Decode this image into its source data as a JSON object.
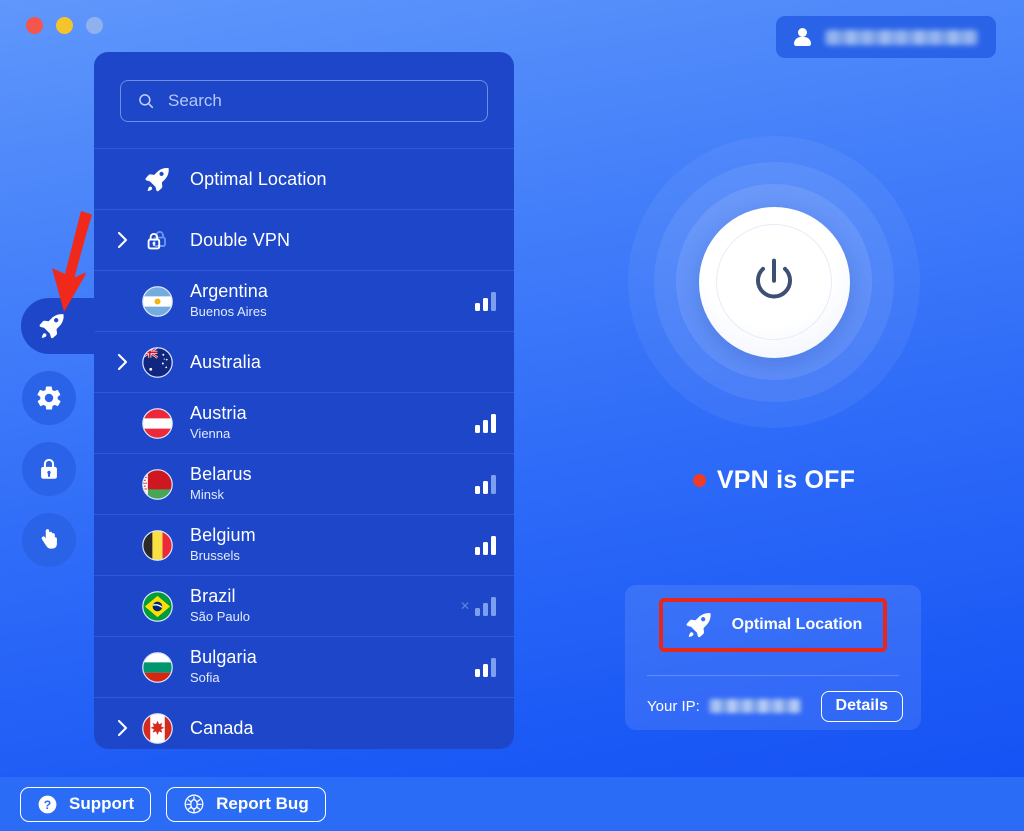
{
  "window": {
    "controls": [
      {
        "name": "close",
        "color": "#f2564d"
      },
      {
        "name": "minimize",
        "color": "#f5c32c"
      },
      {
        "name": "zoom",
        "color": "#8fb2ee"
      }
    ]
  },
  "account": {
    "icon": "person-icon",
    "username": ""
  },
  "sidebar": {
    "items": [
      {
        "id": "locations",
        "icon": "rocket-icon",
        "active": true
      },
      {
        "id": "settings",
        "icon": "gear-icon",
        "active": false
      },
      {
        "id": "security",
        "icon": "lock-icon",
        "active": false
      },
      {
        "id": "block",
        "icon": "hand-icon",
        "active": false
      }
    ]
  },
  "search": {
    "placeholder": "Search",
    "value": "",
    "icon": "search-icon"
  },
  "locations": {
    "special": [
      {
        "label": "Optimal Location",
        "icon": "rocket-icon",
        "expandable": false
      },
      {
        "label": "Double VPN",
        "icon": "double-lock-icon",
        "expandable": true
      }
    ],
    "countries": [
      {
        "name": "Argentina",
        "city": "Buenos Aires",
        "flag": "ar",
        "expandable": false,
        "signal": 2,
        "unavailable": false
      },
      {
        "name": "Australia",
        "city": "",
        "flag": "au",
        "expandable": true,
        "signal": 0,
        "unavailable": false
      },
      {
        "name": "Austria",
        "city": "Vienna",
        "flag": "at",
        "expandable": false,
        "signal": 3,
        "unavailable": false
      },
      {
        "name": "Belarus",
        "city": "Minsk",
        "flag": "by",
        "expandable": false,
        "signal": 2,
        "unavailable": false
      },
      {
        "name": "Belgium",
        "city": "Brussels",
        "flag": "be",
        "expandable": false,
        "signal": 3,
        "unavailable": false
      },
      {
        "name": "Brazil",
        "city": "São Paulo",
        "flag": "br",
        "expandable": false,
        "signal": 3,
        "unavailable": true
      },
      {
        "name": "Bulgaria",
        "city": "Sofia",
        "flag": "bg",
        "expandable": false,
        "signal": 2,
        "unavailable": false
      },
      {
        "name": "Canada",
        "city": "",
        "flag": "ca",
        "expandable": true,
        "signal": 0,
        "unavailable": false
      }
    ]
  },
  "connection": {
    "power_icon": "power-icon",
    "status_text": "VPN is OFF",
    "status_color": "#f03b26",
    "is_on": false
  },
  "location_card": {
    "optimal_label": "Optimal Location",
    "optimal_icon": "rocket-icon",
    "highlight_color": "#e7271a",
    "ip_label": "Your IP:",
    "ip_value": "",
    "details_label": "Details"
  },
  "footer": {
    "support_label": "Support",
    "support_icon": "question-circle-icon",
    "report_label": "Report Bug",
    "report_icon": "bug-icon"
  },
  "annotations": {
    "arrow_color": "#f0291a",
    "arrow_target": "sidebar-item-locations"
  }
}
